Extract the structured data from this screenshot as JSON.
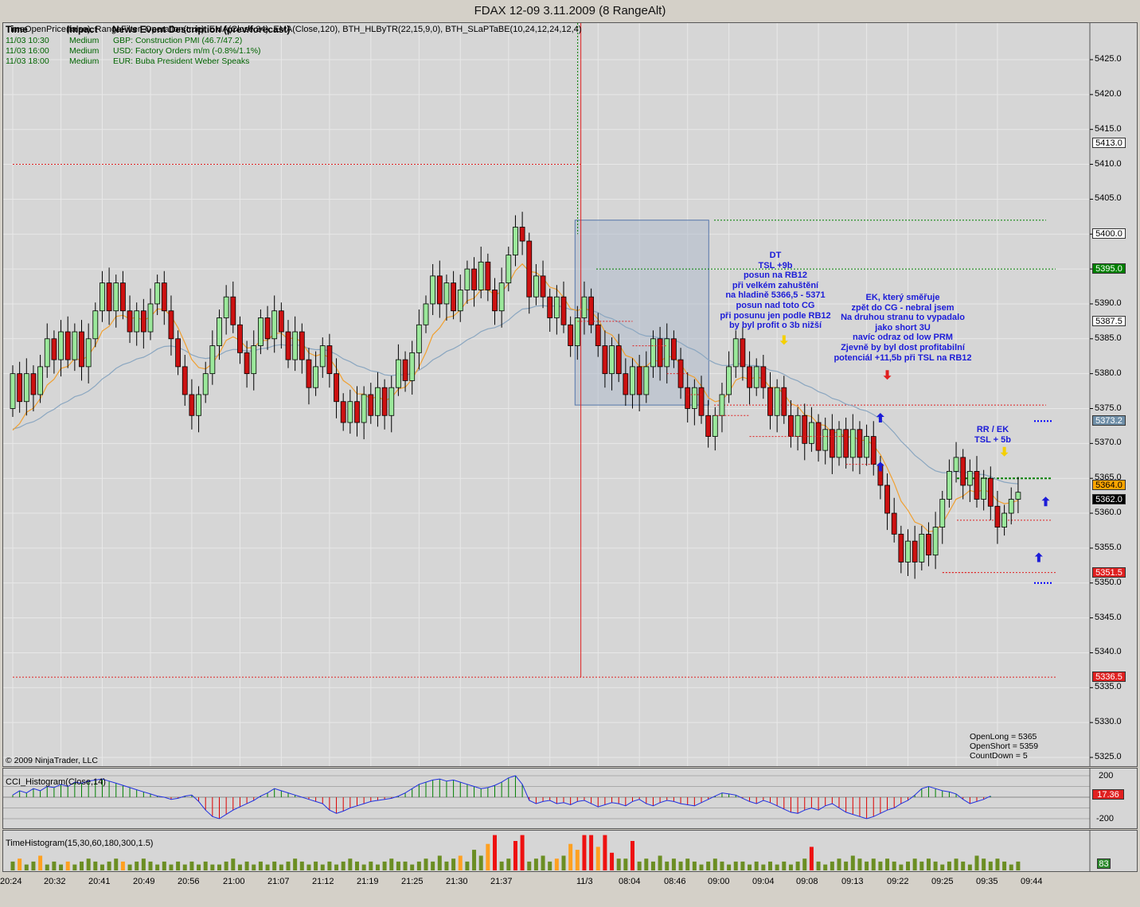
{
  "window": {
    "title": "FDAX 12-09  3.11.2009 (8 RangeAlt)"
  },
  "header": {
    "indicators": "TimeOpenPrice(false), RangeFilter, Operation(true), EMA(Close,34), EMA(Close,120), BTH_HLByTR(22,15,9,0), BTH_SLaPTaBE(10,24,12,24,12,4)",
    "news_columns": {
      "time": "Time",
      "impact": "Impact",
      "description": "News Event Description (prev/forecast)"
    },
    "news": [
      {
        "time": "11/03  10:30",
        "impact": "Medium",
        "event": "GBP: Construction PMI (46.7/47.2)"
      },
      {
        "time": "11/03  16:00",
        "impact": "Medium",
        "event": "USD: Factory Orders m/m (-0.8%/1.1%)"
      },
      {
        "time": "11/03  18:00",
        "impact": "Medium",
        "event": "EUR: Buba President Weber Speaks"
      }
    ]
  },
  "annotations": {
    "dt": [
      "DT",
      "TSL +9b",
      "posun na RB12",
      "při velkém zahuštění",
      "na hladině 5366,5 - 5371",
      "posun nad toto CG",
      "při posunu jen podle RB12",
      "by byl profit o 3b nižší"
    ],
    "ek": [
      "EK, který směřuje",
      "zpět do CG - nebral jsem",
      "Na druhou stranu to vypadalo",
      "jako short 3U",
      "navíc odraz od low PRM",
      "Zjevně by byl dost profitabilní",
      "potenciál +11,5b při TSL na RB12"
    ],
    "rr": [
      "RR / EK",
      "TSL + 5b"
    ]
  },
  "status": {
    "open_long": "OpenLong = 5365",
    "open_short": "OpenShort = 5359",
    "countdown": "CountDown = 5"
  },
  "copyright": "© 2009 NinjaTrader, LLC",
  "price_axis": {
    "ticks": [
      "5425.0",
      "5420.0",
      "5415.0",
      "5410.0",
      "5405.0",
      "5400.0",
      "5395.0",
      "5390.0",
      "5385.0",
      "5380.0",
      "5375.0",
      "5370.0",
      "5365.0",
      "5360.0",
      "5355.0",
      "5350.0",
      "5345.0",
      "5340.0",
      "5335.0",
      "5330.0",
      "5325.0"
    ],
    "tags": [
      {
        "label": "5413.0",
        "price": 5413.0,
        "bg": "#ffffff",
        "fg": "#000000"
      },
      {
        "label": "5400.0",
        "price": 5400.0,
        "bg": "#ffffff",
        "fg": "#000000"
      },
      {
        "label": "5395.0",
        "price": 5395.0,
        "bg": "#008000",
        "fg": "#ffffff"
      },
      {
        "label": "5387.5",
        "price": 5387.5,
        "bg": "#ffffff",
        "fg": "#000000"
      },
      {
        "label": "5373.2",
        "price": 5373.2,
        "bg": "#6f8fa8",
        "fg": "#ffffff"
      },
      {
        "label": "5364.0",
        "price": 5364.0,
        "bg": "#ffa500",
        "fg": "#000000"
      },
      {
        "label": "5362.0",
        "price": 5362.0,
        "bg": "#000000",
        "fg": "#ffffff"
      },
      {
        "label": "5351.5",
        "price": 5351.5,
        "bg": "#e02020",
        "fg": "#ffffff"
      },
      {
        "label": "5336.5",
        "price": 5336.5,
        "bg": "#e02020",
        "fg": "#ffffff"
      }
    ]
  },
  "cci_panel": {
    "label": "CCI_Histogram(Close,14)",
    "ticks": [
      "200",
      "-200"
    ],
    "value_tag": "17.36",
    "value": 17.36
  },
  "time_panel": {
    "label": "TimeHistogram(15,30,60,180,300,1.5)",
    "value_tag": "83",
    "value": 83
  },
  "x_axis": {
    "labels": [
      "20:24",
      "20:32",
      "20:41",
      "20:49",
      "20:56",
      "21:00",
      "21:07",
      "21:12",
      "21:19",
      "21:25",
      "21:30",
      "21:37",
      "11/3",
      "08:04",
      "08:46",
      "09:00",
      "09:04",
      "09:08",
      "09:13",
      "09:22",
      "09:25",
      "09:35",
      "09:44"
    ]
  },
  "colors": {
    "up": "#9be89b",
    "down": "#cc1111",
    "ema34": "#f0a030",
    "ema120": "#8aa6c0",
    "cci_up": "#008000",
    "cci_down": "#dd0000"
  },
  "chart_data": {
    "type": "candlestick",
    "ylim": [
      5322,
      5429
    ],
    "brick_size": 4,
    "bars": [
      [
        5375,
        5380
      ],
      [
        5380,
        5376
      ],
      [
        5376,
        5380
      ],
      [
        5380,
        5377
      ],
      [
        5377,
        5381
      ],
      [
        5381,
        5385
      ],
      [
        5385,
        5382
      ],
      [
        5382,
        5386
      ],
      [
        5386,
        5382
      ],
      [
        5382,
        5386
      ],
      [
        5386,
        5381
      ],
      [
        5381,
        5385
      ],
      [
        5385,
        5389
      ],
      [
        5389,
        5393
      ],
      [
        5393,
        5389
      ],
      [
        5389,
        5393
      ],
      [
        5393,
        5389
      ],
      [
        5389,
        5386
      ],
      [
        5386,
        5389
      ],
      [
        5389,
        5386
      ],
      [
        5386,
        5390
      ],
      [
        5390,
        5393
      ],
      [
        5393,
        5389
      ],
      [
        5389,
        5385
      ],
      [
        5385,
        5381
      ],
      [
        5381,
        5377
      ],
      [
        5377,
        5374
      ],
      [
        5374,
        5377
      ],
      [
        5377,
        5380
      ],
      [
        5380,
        5384
      ],
      [
        5384,
        5388
      ],
      [
        5388,
        5391
      ],
      [
        5391,
        5387
      ],
      [
        5387,
        5383
      ],
      [
        5383,
        5380
      ],
      [
        5380,
        5384
      ],
      [
        5384,
        5388
      ],
      [
        5388,
        5385
      ],
      [
        5385,
        5389
      ],
      [
        5389,
        5386
      ],
      [
        5386,
        5382
      ],
      [
        5382,
        5386
      ],
      [
        5386,
        5382
      ],
      [
        5382,
        5378
      ],
      [
        5378,
        5381
      ],
      [
        5381,
        5384
      ],
      [
        5384,
        5380
      ],
      [
        5380,
        5376
      ],
      [
        5376,
        5373
      ],
      [
        5373,
        5376
      ],
      [
        5376,
        5373
      ],
      [
        5373,
        5377
      ],
      [
        5377,
        5374
      ],
      [
        5374,
        5378
      ],
      [
        5378,
        5374
      ],
      [
        5374,
        5378
      ],
      [
        5378,
        5382
      ],
      [
        5382,
        5379
      ],
      [
        5379,
        5383
      ],
      [
        5383,
        5387
      ],
      [
        5387,
        5390
      ],
      [
        5390,
        5394
      ],
      [
        5394,
        5390
      ],
      [
        5390,
        5393
      ],
      [
        5393,
        5389
      ],
      [
        5389,
        5392
      ],
      [
        5392,
        5395
      ],
      [
        5395,
        5392
      ],
      [
        5392,
        5396
      ],
      [
        5396,
        5392
      ],
      [
        5392,
        5389
      ],
      [
        5389,
        5393
      ],
      [
        5393,
        5397
      ],
      [
        5397,
        5401
      ],
      [
        5401,
        5399
      ],
      [
        5399,
        5391
      ],
      [
        5391,
        5394
      ],
      [
        5394,
        5391
      ],
      [
        5391,
        5388
      ],
      [
        5388,
        5391
      ],
      [
        5391,
        5387
      ],
      [
        5387,
        5384
      ],
      [
        5384,
        5388
      ],
      [
        5388,
        5391
      ],
      [
        5391,
        5387
      ],
      [
        5387,
        5384
      ],
      [
        5384,
        5380
      ],
      [
        5380,
        5384
      ],
      [
        5384,
        5380
      ],
      [
        5380,
        5377
      ],
      [
        5377,
        5381
      ],
      [
        5381,
        5377
      ],
      [
        5377,
        5381
      ],
      [
        5381,
        5385
      ],
      [
        5385,
        5381
      ],
      [
        5381,
        5385
      ],
      [
        5385,
        5382
      ],
      [
        5382,
        5378
      ],
      [
        5378,
        5375
      ],
      [
        5375,
        5378
      ],
      [
        5378,
        5374
      ],
      [
        5374,
        5371
      ],
      [
        5371,
        5374
      ],
      [
        5374,
        5377
      ],
      [
        5377,
        5381
      ],
      [
        5381,
        5385
      ],
      [
        5385,
        5381
      ],
      [
        5381,
        5378
      ],
      [
        5378,
        5381
      ],
      [
        5381,
        5378
      ],
      [
        5378,
        5374
      ],
      [
        5374,
        5378
      ],
      [
        5378,
        5374
      ],
      [
        5374,
        5371
      ],
      [
        5371,
        5374
      ],
      [
        5374,
        5370
      ],
      [
        5370,
        5373
      ],
      [
        5373,
        5369
      ],
      [
        5369,
        5372
      ],
      [
        5372,
        5368
      ],
      [
        5368,
        5372
      ],
      [
        5372,
        5368
      ],
      [
        5368,
        5372
      ],
      [
        5372,
        5368
      ],
      [
        5368,
        5371
      ],
      [
        5371,
        5367
      ],
      [
        5367,
        5364
      ],
      [
        5364,
        5360
      ],
      [
        5360,
        5357
      ],
      [
        5357,
        5353
      ],
      [
        5353,
        5356
      ],
      [
        5356,
        5353
      ],
      [
        5353,
        5357
      ],
      [
        5357,
        5354
      ],
      [
        5354,
        5358
      ],
      [
        5358,
        5362
      ],
      [
        5362,
        5366
      ],
      [
        5366,
        5368
      ],
      [
        5368,
        5364
      ],
      [
        5364,
        5366
      ],
      [
        5366,
        5362
      ],
      [
        5362,
        5365
      ],
      [
        5365,
        5361
      ],
      [
        5361,
        5358
      ],
      [
        5358,
        5360
      ],
      [
        5360,
        5362
      ],
      [
        5362,
        5363
      ]
    ],
    "cci": [
      20,
      60,
      40,
      80,
      60,
      100,
      90,
      120,
      100,
      140,
      130,
      150,
      160,
      170,
      150,
      130,
      110,
      90,
      70,
      50,
      30,
      10,
      0,
      -20,
      -10,
      10,
      20,
      -40,
      -120,
      -180,
      -200,
      -160,
      -120,
      -90,
      -60,
      -30,
      10,
      40,
      80,
      60,
      40,
      20,
      0,
      -20,
      -40,
      -60,
      -120,
      -150,
      -130,
      -100,
      -80,
      -60,
      -40,
      -30,
      -20,
      -10,
      10,
      40,
      80,
      120,
      140,
      160,
      170,
      150,
      160,
      140,
      120,
      100,
      80,
      90,
      110,
      140,
      180,
      200,
      120,
      -30,
      -60,
      -40,
      -30,
      -60,
      -50,
      -70,
      -40,
      -30,
      -60,
      -90,
      -70,
      -50,
      -60,
      -80,
      -40,
      -20,
      -60,
      -80,
      -50,
      -30,
      -40,
      -60,
      -70,
      -80,
      -50,
      -20,
      10,
      40,
      30,
      20,
      -10,
      -40,
      -60,
      -30,
      -50,
      -80,
      -110,
      -140,
      -150,
      -120,
      -100,
      -120,
      -80,
      -60,
      -100,
      -140,
      -160,
      -180,
      -200,
      -180,
      -150,
      -120,
      -100,
      -60,
      -30,
      20,
      80,
      100,
      80,
      60,
      50,
      30,
      -20,
      -60,
      -40,
      -20,
      10
    ],
    "time_hist": [
      [
        3,
        "g"
      ],
      [
        4,
        "o"
      ],
      [
        2,
        "g"
      ],
      [
        3,
        "g"
      ],
      [
        5,
        "o"
      ],
      [
        2,
        "g"
      ],
      [
        3,
        "g"
      ],
      [
        2,
        "g"
      ],
      [
        3,
        "o"
      ],
      [
        2,
        "g"
      ],
      [
        3,
        "g"
      ],
      [
        4,
        "g"
      ],
      [
        3,
        "g"
      ],
      [
        2,
        "g"
      ],
      [
        3,
        "g"
      ],
      [
        4,
        "g"
      ],
      [
        3,
        "o"
      ],
      [
        2,
        "g"
      ],
      [
        3,
        "g"
      ],
      [
        4,
        "g"
      ],
      [
        3,
        "g"
      ],
      [
        2,
        "g"
      ],
      [
        3,
        "g"
      ],
      [
        2,
        "g"
      ],
      [
        3,
        "g"
      ],
      [
        2,
        "g"
      ],
      [
        3,
        "g"
      ],
      [
        2,
        "g"
      ],
      [
        3,
        "g"
      ],
      [
        2,
        "g"
      ],
      [
        2,
        "g"
      ],
      [
        3,
        "g"
      ],
      [
        4,
        "g"
      ],
      [
        2,
        "g"
      ],
      [
        3,
        "g"
      ],
      [
        2,
        "g"
      ],
      [
        3,
        "g"
      ],
      [
        2,
        "g"
      ],
      [
        3,
        "g"
      ],
      [
        2,
        "g"
      ],
      [
        3,
        "g"
      ],
      [
        4,
        "g"
      ],
      [
        3,
        "g"
      ],
      [
        2,
        "g"
      ],
      [
        3,
        "g"
      ],
      [
        2,
        "g"
      ],
      [
        3,
        "g"
      ],
      [
        2,
        "g"
      ],
      [
        3,
        "g"
      ],
      [
        4,
        "g"
      ],
      [
        3,
        "g"
      ],
      [
        2,
        "g"
      ],
      [
        3,
        "g"
      ],
      [
        2,
        "g"
      ],
      [
        3,
        "g"
      ],
      [
        4,
        "g"
      ],
      [
        3,
        "g"
      ],
      [
        3,
        "g"
      ],
      [
        2,
        "g"
      ],
      [
        3,
        "g"
      ],
      [
        4,
        "g"
      ],
      [
        3,
        "g"
      ],
      [
        5,
        "g"
      ],
      [
        3,
        "g"
      ],
      [
        4,
        "g"
      ],
      [
        5,
        "o"
      ],
      [
        3,
        "g"
      ],
      [
        7,
        "g"
      ],
      [
        5,
        "g"
      ],
      [
        9,
        "o"
      ],
      [
        12,
        "r"
      ],
      [
        3,
        "g"
      ],
      [
        4,
        "g"
      ],
      [
        10,
        "r"
      ],
      [
        12,
        "r"
      ],
      [
        3,
        "g"
      ],
      [
        4,
        "g"
      ],
      [
        5,
        "g"
      ],
      [
        3,
        "g"
      ],
      [
        4,
        "o"
      ],
      [
        5,
        "g"
      ],
      [
        9,
        "o"
      ],
      [
        7,
        "o"
      ],
      [
        12,
        "r"
      ],
      [
        12,
        "r"
      ],
      [
        8,
        "o"
      ],
      [
        12,
        "r"
      ],
      [
        6,
        "r"
      ],
      [
        4,
        "g"
      ],
      [
        4,
        "g"
      ],
      [
        10,
        "r"
      ],
      [
        3,
        "g"
      ],
      [
        4,
        "g"
      ],
      [
        3,
        "g"
      ],
      [
        5,
        "g"
      ],
      [
        3,
        "g"
      ],
      [
        4,
        "g"
      ],
      [
        3,
        "g"
      ],
      [
        4,
        "g"
      ],
      [
        3,
        "g"
      ],
      [
        2,
        "g"
      ],
      [
        3,
        "g"
      ],
      [
        4,
        "g"
      ],
      [
        3,
        "g"
      ],
      [
        2,
        "g"
      ],
      [
        3,
        "g"
      ],
      [
        3,
        "g"
      ],
      [
        2,
        "g"
      ],
      [
        3,
        "g"
      ],
      [
        2,
        "g"
      ],
      [
        3,
        "g"
      ],
      [
        2,
        "g"
      ],
      [
        3,
        "g"
      ],
      [
        2,
        "g"
      ],
      [
        3,
        "g"
      ],
      [
        4,
        "g"
      ],
      [
        8,
        "r"
      ],
      [
        3,
        "g"
      ],
      [
        2,
        "g"
      ],
      [
        3,
        "g"
      ],
      [
        4,
        "g"
      ],
      [
        3,
        "g"
      ],
      [
        5,
        "g"
      ],
      [
        4,
        "g"
      ],
      [
        3,
        "g"
      ],
      [
        4,
        "g"
      ],
      [
        3,
        "g"
      ],
      [
        4,
        "g"
      ],
      [
        3,
        "g"
      ],
      [
        2,
        "g"
      ],
      [
        3,
        "g"
      ],
      [
        4,
        "g"
      ],
      [
        3,
        "g"
      ],
      [
        4,
        "g"
      ],
      [
        3,
        "g"
      ],
      [
        2,
        "g"
      ],
      [
        3,
        "g"
      ],
      [
        4,
        "g"
      ],
      [
        3,
        "g"
      ],
      [
        2,
        "g"
      ],
      [
        5,
        "g"
      ],
      [
        4,
        "g"
      ],
      [
        3,
        "g"
      ],
      [
        4,
        "g"
      ],
      [
        3,
        "g"
      ],
      [
        2,
        "g"
      ],
      [
        3,
        "g"
      ]
    ],
    "levels": [
      {
        "name": "upper-red",
        "price": 5410.0,
        "color": "#e02020"
      },
      {
        "name": "green-top",
        "price": 5402.0,
        "color": "#008000"
      },
      {
        "name": "green-395",
        "price": 5395.0,
        "color": "#008000"
      },
      {
        "name": "red-375",
        "price": 5375.5,
        "color": "#e02020"
      },
      {
        "name": "green-365",
        "price": 5365.0,
        "color": "#008000"
      },
      {
        "name": "red-359",
        "price": 5359.0,
        "color": "#e02020"
      },
      {
        "name": "red-351",
        "price": 5351.5,
        "color": "#e02020"
      },
      {
        "name": "red-336",
        "price": 5336.5,
        "color": "#e02020"
      },
      {
        "name": "blue-373",
        "price": 5373.2,
        "color": "#0000ff"
      },
      {
        "name": "blue-350",
        "price": 5350.0,
        "color": "#0000ff"
      }
    ]
  }
}
